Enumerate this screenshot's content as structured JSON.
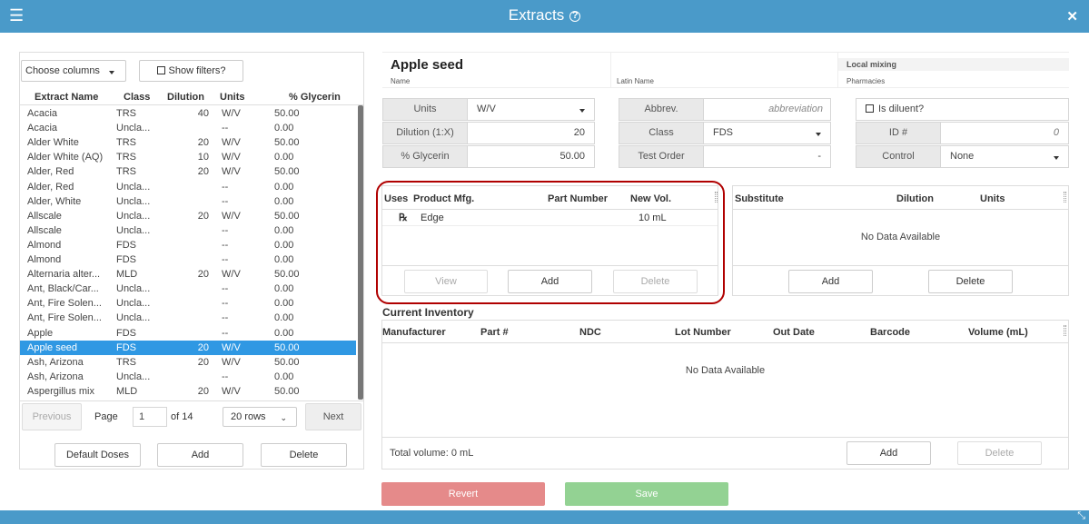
{
  "window": {
    "title": "Extracts"
  },
  "left": {
    "choose_columns": "Choose columns",
    "show_filters": "Show filters?",
    "columns": [
      "Extract Name",
      "Class",
      "Dilution",
      "Units",
      "% Glycerin"
    ],
    "rows": [
      {
        "name": "Acacia",
        "class": "TRS",
        "dilution": "40",
        "units": "W/V",
        "glycerin": "50.00"
      },
      {
        "name": "Acacia",
        "class": "Uncla...",
        "dilution": "",
        "units": "--",
        "glycerin": "0.00"
      },
      {
        "name": "Alder White",
        "class": "TRS",
        "dilution": "20",
        "units": "W/V",
        "glycerin": "50.00"
      },
      {
        "name": "Alder White (AQ)",
        "class": "TRS",
        "dilution": "10",
        "units": "W/V",
        "glycerin": "0.00"
      },
      {
        "name": "Alder, Red",
        "class": "TRS",
        "dilution": "20",
        "units": "W/V",
        "glycerin": "50.00"
      },
      {
        "name": "Alder, Red",
        "class": "Uncla...",
        "dilution": "",
        "units": "--",
        "glycerin": "0.00"
      },
      {
        "name": "Alder, White",
        "class": "Uncla...",
        "dilution": "",
        "units": "--",
        "glycerin": "0.00"
      },
      {
        "name": "Allscale",
        "class": "Uncla...",
        "dilution": "20",
        "units": "W/V",
        "glycerin": "50.00"
      },
      {
        "name": "Allscale",
        "class": "Uncla...",
        "dilution": "",
        "units": "--",
        "glycerin": "0.00"
      },
      {
        "name": "Almond",
        "class": "FDS",
        "dilution": "",
        "units": "--",
        "glycerin": "0.00"
      },
      {
        "name": "Almond",
        "class": "FDS",
        "dilution": "",
        "units": "--",
        "glycerin": "0.00"
      },
      {
        "name": "Alternaria alter...",
        "class": "MLD",
        "dilution": "20",
        "units": "W/V",
        "glycerin": "50.00"
      },
      {
        "name": "Ant, Black/Car...",
        "class": "Uncla...",
        "dilution": "",
        "units": "--",
        "glycerin": "0.00"
      },
      {
        "name": "Ant, Fire Solen...",
        "class": "Uncla...",
        "dilution": "",
        "units": "--",
        "glycerin": "0.00"
      },
      {
        "name": "Ant, Fire Solen...",
        "class": "Uncla...",
        "dilution": "",
        "units": "--",
        "glycerin": "0.00"
      },
      {
        "name": "Apple",
        "class": "FDS",
        "dilution": "",
        "units": "--",
        "glycerin": "0.00"
      },
      {
        "name": "Apple seed",
        "class": "FDS",
        "dilution": "20",
        "units": "W/V",
        "glycerin": "50.00"
      },
      {
        "name": "Ash, Arizona",
        "class": "TRS",
        "dilution": "20",
        "units": "W/V",
        "glycerin": "50.00"
      },
      {
        "name": "Ash, Arizona",
        "class": "Uncla...",
        "dilution": "",
        "units": "--",
        "glycerin": "0.00"
      },
      {
        "name": "Aspergillus mix",
        "class": "MLD",
        "dilution": "20",
        "units": "W/V",
        "glycerin": "50.00"
      }
    ],
    "selected_index": 16,
    "pager": {
      "previous": "Previous",
      "page_label": "Page",
      "page": "1",
      "of": "of 14",
      "rows": "20 rows",
      "next": "Next"
    },
    "buttons": {
      "default_doses": "Default Doses",
      "add": "Add",
      "delete": "Delete"
    }
  },
  "detail": {
    "name": "Apple seed",
    "name_label": "Name",
    "latin_label": "Latin Name",
    "local_mixing": "Local mixing",
    "pharmacies_label": "Pharmacies",
    "units_label": "Units",
    "units_value": "W/V",
    "dilution_label": "Dilution (1:X)",
    "dilution_value": "20",
    "glycerin_label": "% Glycerin",
    "glycerin_value": "50.00",
    "abbrev_label": "Abbrev.",
    "abbrev_placeholder": "abbreviation",
    "class_label": "Class",
    "class_value": "FDS",
    "test_order_label": "Test Order",
    "test_order_value": "-",
    "is_diluent": "Is diluent?",
    "id_label": "ID #",
    "id_value": "0",
    "control_label": "Control",
    "control_value": "None"
  },
  "products": {
    "columns": [
      "Uses",
      "Product Mfg.",
      "Part Number",
      "New Vol."
    ],
    "rows": [
      {
        "uses": "℞",
        "mfg": "Edge",
        "part": "",
        "vol": "10 mL"
      }
    ],
    "buttons": {
      "view": "View",
      "add": "Add",
      "delete": "Delete"
    }
  },
  "substitutes": {
    "columns": [
      "Substitute",
      "Dilution",
      "Units"
    ],
    "empty": "No Data Available",
    "buttons": {
      "add": "Add",
      "delete": "Delete"
    }
  },
  "inventory": {
    "title": "Current Inventory",
    "columns": [
      "Manufacturer",
      "Part #",
      "NDC",
      "Lot Number",
      "Out Date",
      "Barcode",
      "Volume (mL)"
    ],
    "empty": "No Data Available",
    "total": "Total volume: 0 mL",
    "buttons": {
      "add": "Add",
      "delete": "Delete"
    }
  },
  "actions": {
    "revert": "Revert",
    "save": "Save"
  },
  "colors": {
    "header": "#4a9ac9",
    "selected": "#2f98e3",
    "revert": "#e58a8a",
    "save": "#93d293",
    "highlight": "#b00000"
  }
}
